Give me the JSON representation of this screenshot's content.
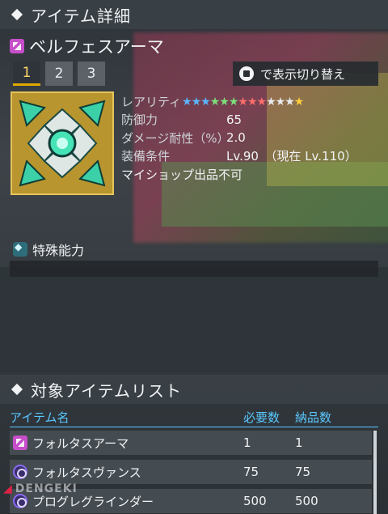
{
  "header": {
    "title": "アイテム詳細"
  },
  "item": {
    "name": "ベルフェスアーマ",
    "tabs": [
      "1",
      "2",
      "3"
    ],
    "toggle_label": "で表示切り替え",
    "properties": [
      {
        "label": "レアリティ",
        "value": ""
      },
      {
        "label": "防御力",
        "value": "65"
      },
      {
        "label": "ダメージ耐性（%）",
        "value": "2.0"
      },
      {
        "label": "装備条件",
        "value": "Lv.90　（現在 Lv.110）"
      }
    ],
    "rarity_stars": 13,
    "star_colors": [
      "#5bb6ff",
      "#5bb6ff",
      "#5bb6ff",
      "#7de07a",
      "#7de07a",
      "#7de07a",
      "#ff6d6d",
      "#ff6d6d",
      "#ff6d6d",
      "#e8eaee",
      "#e8eaee",
      "#e8eaee",
      "#ffcf3d"
    ],
    "note": "マイショップ出品不可"
  },
  "special": {
    "label": "特殊能力"
  },
  "list": {
    "title": "対象アイテムリスト",
    "columns": [
      "アイテム名",
      "必要数",
      "納品数"
    ],
    "rows": [
      {
        "icon": "armor-icon",
        "name": "フォルタスアーマ",
        "required": "1",
        "delivered": "1"
      },
      {
        "icon": "unit-icon",
        "name": "フォルタスヴァンス",
        "required": "75",
        "delivered": "75"
      },
      {
        "icon": "unit-icon",
        "name": "プログレグラインダー",
        "required": "500",
        "delivered": "500"
      }
    ]
  },
  "watermark": "DENGEKI"
}
